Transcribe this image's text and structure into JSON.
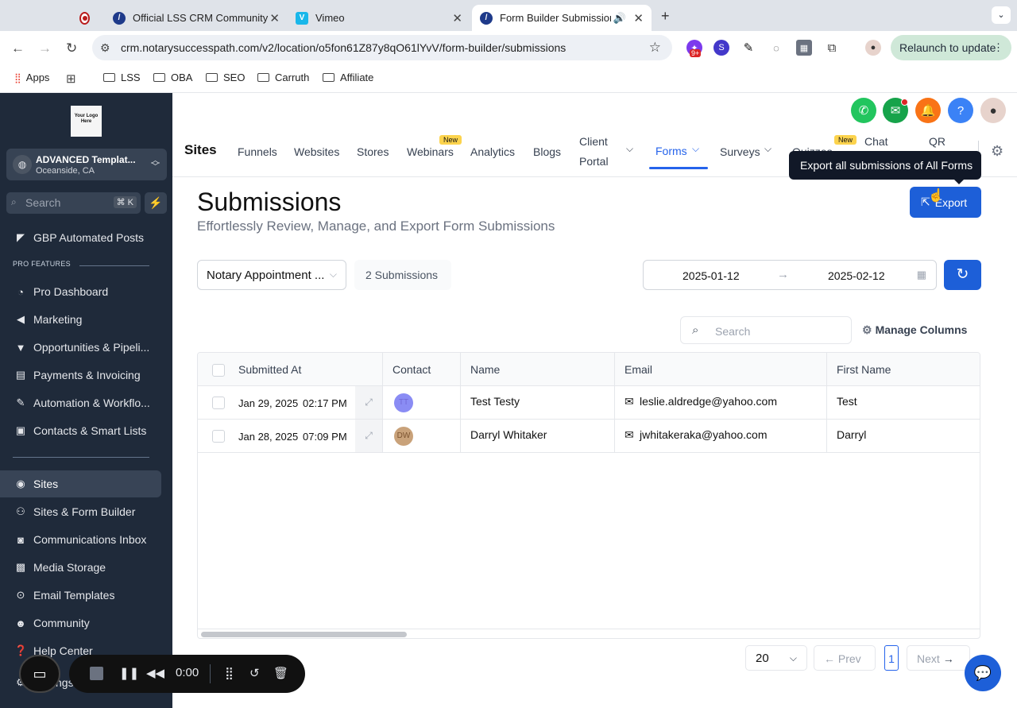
{
  "browser": {
    "tabs": [
      {
        "label": "",
        "type": "recording"
      },
      {
        "label": "Official LSS CRM Community"
      },
      {
        "label": "Vimeo"
      },
      {
        "label": "Form Builder Submissions"
      }
    ],
    "url": "crm.notarysuccesspath.com/v2/location/o5fon61Z87y8qO61lYvV/form-builder/submissions",
    "extension_badge": "9+",
    "relaunch_label": "Relaunch to update",
    "bookmarks": [
      "Apps",
      "LSS",
      "OBA",
      "SEO",
      "Carruth",
      "Affiliate"
    ]
  },
  "sidebar": {
    "logo_text": "Your Logo Here",
    "account_name": "ADVANCED Templat...",
    "account_location": "Oceanside, CA",
    "search_placeholder": "Search",
    "search_shortcut": "⌘ K",
    "top_item": "GBP Automated Posts",
    "section_label": "PRO FEATURES",
    "pro_items": [
      "Pro Dashboard",
      "Marketing",
      "Opportunities & Pipeli...",
      "Payments & Invoicing",
      "Automation & Workflo...",
      "Contacts & Smart Lists"
    ],
    "items": [
      "Sites",
      "Sites & Form Builder",
      "Communications Inbox",
      "Media Storage",
      "Email Templates",
      "Community",
      "Help Center",
      "Settings"
    ],
    "active_item": "Sites"
  },
  "header": {
    "section_title": "Sites",
    "nav": {
      "funnels": "Funnels",
      "websites": "Websites",
      "stores": "Stores",
      "webinars": "Webinars",
      "analytics": "Analytics",
      "blogs": "Blogs",
      "client_portal_1": "Client",
      "client_portal_2": "Portal",
      "forms": "Forms",
      "surveys": "Surveys",
      "quizzes": "Quizzes",
      "chat": "Chat",
      "qr": "QR"
    },
    "new_badge": "New",
    "tooltip": "Export all submissions of All Forms"
  },
  "page": {
    "title": "Submissions",
    "subtitle": "Effortlessly Review, Manage, and Export Form Submissions",
    "export_label": "Export",
    "form_select": "Notary Appointment ...",
    "submission_count": "2 Submissions",
    "date_start": "2025-01-12",
    "date_end": "2025-02-12",
    "search_placeholder": "Search",
    "manage_columns": "Manage Columns"
  },
  "table": {
    "columns": [
      "Submitted At",
      "Contact",
      "Name",
      "Email",
      "First Name"
    ],
    "rows": [
      {
        "date": "Jan 29, 2025",
        "time": "02:17 PM",
        "initials": "TT",
        "name": "Test Testy",
        "email": "leslie.aldredge@yahoo.com",
        "first_name": "Test"
      },
      {
        "date": "Jan 28, 2025",
        "time": "07:09 PM",
        "initials": "DW",
        "name": "Darryl Whitaker",
        "email": "jwhitakeraka@yahoo.com",
        "first_name": "Darryl"
      }
    ]
  },
  "pagination": {
    "per_page": "20",
    "prev": "Prev",
    "page": "1",
    "next": "Next"
  },
  "recorder": {
    "time": "0:00"
  },
  "colors": {
    "primary": "#1d5fd8",
    "sidebar_bg": "#1f2a3a",
    "new_badge": "#fcd34d"
  }
}
